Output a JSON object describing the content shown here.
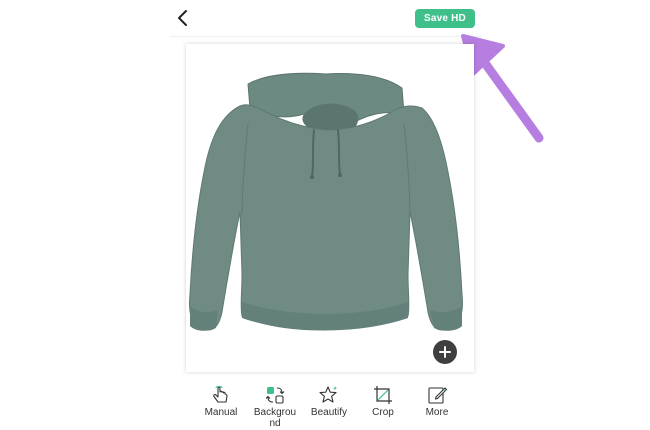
{
  "header": {
    "back_icon": "chevron-left-icon",
    "save_label": "Save HD"
  },
  "colors": {
    "accent": "#3fc08b",
    "arrow": "#b57ee0",
    "garment": "#6f8b84"
  },
  "canvas": {
    "add_icon": "plus-icon"
  },
  "toolbar": {
    "items": [
      {
        "label": "Manual",
        "icon": "hand-pointer-icon"
      },
      {
        "label": "Backgrou\nnd",
        "icon": "background-swap-icon"
      },
      {
        "label": "Beautify",
        "icon": "sparkle-star-icon"
      },
      {
        "label": "Crop",
        "icon": "crop-icon"
      },
      {
        "label": "More",
        "icon": "edit-pencil-icon"
      }
    ]
  }
}
